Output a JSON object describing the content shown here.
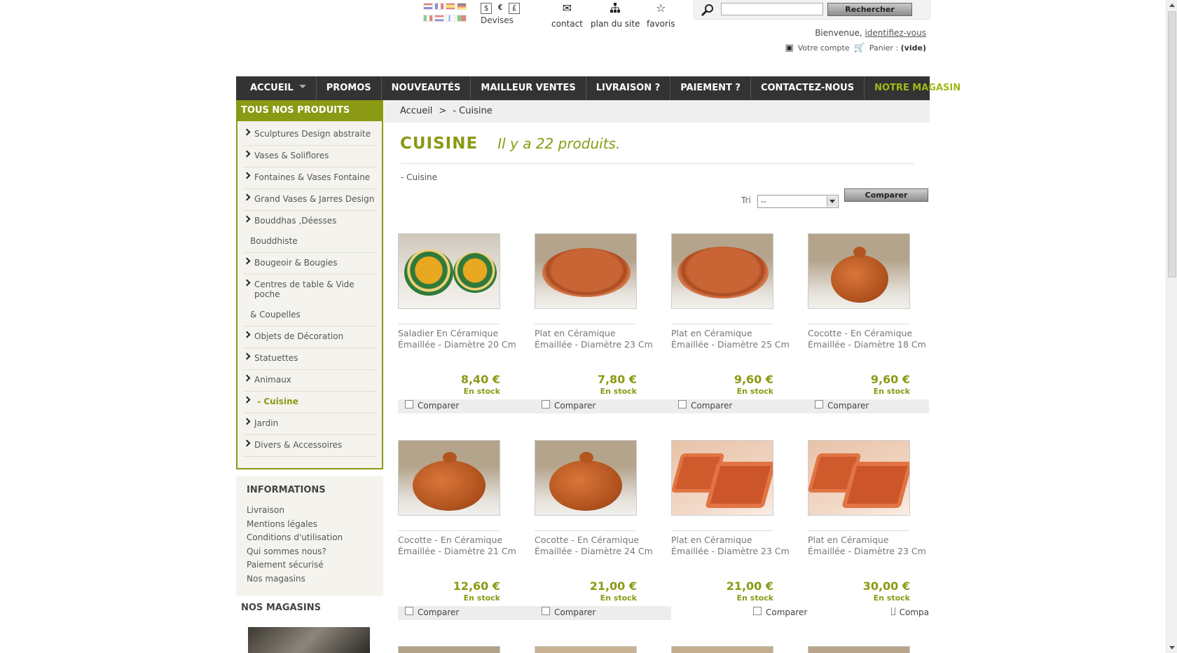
{
  "header": {
    "currency_symbols": [
      "$",
      "€",
      "£"
    ],
    "devises_label": "Devises",
    "links": [
      {
        "label": "contact",
        "icon": "envelope-icon"
      },
      {
        "label": "plan du site",
        "icon": "sitemap-icon"
      },
      {
        "label": "favoris",
        "icon": "star-icon"
      }
    ],
    "search": {
      "value": "",
      "button_label": "Rechercher"
    },
    "welcome_text": "Bienvenue,",
    "login_link": "identifiez-vous",
    "account_label": "Votre compte",
    "cart_label": "Panier :",
    "cart_status": "(vide)"
  },
  "nav": {
    "items": [
      "ACCUEIL",
      "PROMOS",
      "NOUVEAUTÉS",
      "MAILLEUR VENTES",
      "LIVRAISON ?",
      "PAIEMENT ?",
      "CONTACTEZ-NOUS",
      "NOTRE MAGASIN"
    ]
  },
  "sidebar": {
    "categories_title": "TOUS NOS PRODUITS",
    "categories": [
      {
        "label": "Sculptures Design abstraite"
      },
      {
        "label": "Vases & Soliflores"
      },
      {
        "label": "Fontaines & Vases Fontaine"
      },
      {
        "label": "Grand Vases & Jarres Design"
      },
      {
        "label": "Bouddhas ,Déesses",
        "line2": "Bouddhiste"
      },
      {
        "label": "Bougeoir & Bougies"
      },
      {
        "label": "Centres de table & Vide poche",
        "line2": "& Coupelles"
      },
      {
        "label": "Objets de Décoration"
      },
      {
        "label": "Statuettes"
      },
      {
        "label": "Animaux"
      },
      {
        "label": "- Cuisine"
      },
      {
        "label": "Jardin"
      },
      {
        "label": "Divers & Accessoires"
      }
    ],
    "info_title": "INFORMATIONS",
    "info_links": [
      "Livraison",
      "Mentions légales",
      "Conditions d'utilisation",
      "Qui sommes nous?",
      "Paiement sécurisé",
      "Nos magasins"
    ],
    "stores_title": "NOS MAGASINS"
  },
  "main": {
    "breadcrumb": {
      "home": "Accueil",
      "separator": ">",
      "current": "- Cuisine"
    },
    "title": "CUISINE",
    "product_count": "Il y a 22 produits.",
    "subcategory": "- Cuisine",
    "sort_label": "Tri",
    "sort_value": "--",
    "compare_button": "Comparer",
    "products": [
      {
        "name": "Saladier En Céramique Émaillée - Diamètre 20 Cm",
        "price": "8,40 €",
        "stock": "En stock",
        "compare": "Comparer"
      },
      {
        "name": "Plat en Céramique Émaillée - Diamètre 23 Cm",
        "price": "7,80 €",
        "stock": "En stock",
        "compare": "Comparer"
      },
      {
        "name": "Plat en Céramique Émaillée - Diamètre 25 Cm",
        "price": "9,60 €",
        "stock": "En stock",
        "compare": "Comparer"
      },
      {
        "name": "Cocotte - En Céramique Émaillée - Diamètre 18 Cm",
        "price": "9,60 €",
        "stock": "En stock",
        "compare": "Comparer"
      },
      {
        "name": "Cocotte - En Céramique Émaillée - Diamètre 21 Cm",
        "price": "12,60 €",
        "stock": "En stock",
        "compare": "Comparer"
      },
      {
        "name": "Cocotte - En Céramique Émaillée - Diamètre 24 Cm",
        "price": "21,00 €",
        "stock": "En stock",
        "compare": "Comparer"
      },
      {
        "name": "Plat en Céramique Émaillée - Diamètre 23 Cm",
        "price": "21,00 €",
        "stock": "En stock",
        "compare": "Comparer"
      },
      {
        "name": "Plat en Céramique Émaillée - Diamètre 23 Cm",
        "price": "30,00 €",
        "stock": "En stock",
        "compare": "Compa"
      }
    ]
  },
  "colors": {
    "accent": "#8a9a14",
    "nav_bg": "#333333",
    "terracotta": "#c0622d"
  }
}
